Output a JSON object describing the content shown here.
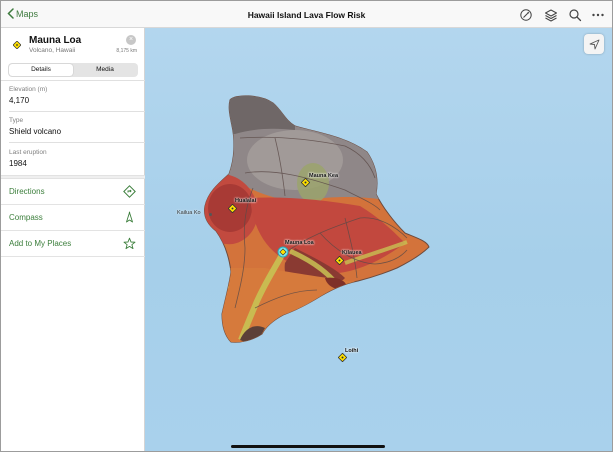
{
  "topbar": {
    "back_label": "Maps",
    "title": "Hawaii Island Lava Flow Risk",
    "tools": [
      "sketch-icon",
      "layers-icon",
      "search-icon",
      "more-icon"
    ]
  },
  "place": {
    "name": "Mauna Loa",
    "subtitle": "Volcano, Hawaii",
    "distance": "8,175 km",
    "tabs": [
      {
        "label": "Details",
        "active": true
      },
      {
        "label": "Media",
        "active": false
      }
    ],
    "fields": [
      {
        "label": "Elevation (m)",
        "value": "4,170"
      },
      {
        "label": "Type",
        "value": "Shield volcano"
      },
      {
        "label": "Last eruption",
        "value": "1984"
      }
    ],
    "actions": [
      {
        "label": "Directions",
        "icon": "directions-icon"
      },
      {
        "label": "Compass",
        "icon": "compass-icon"
      },
      {
        "label": "Add to My Places",
        "icon": "star-icon"
      }
    ]
  },
  "map": {
    "labels": {
      "mauna_kea": "Mauna Kea",
      "hualalai": "Hualalai",
      "kailua": "Kailua Ko",
      "mauna_loa": "Mauna Loa",
      "kilauea": "Kilauea",
      "loihi": "Loihi"
    },
    "colors": {
      "accent": "#3b7e3b",
      "ocean": "#a9d1ec",
      "risk_high": "#c7433f",
      "risk_medium": "#d8703a",
      "risk_low": "#c99a4c",
      "older_flow": "#8a8282"
    }
  }
}
